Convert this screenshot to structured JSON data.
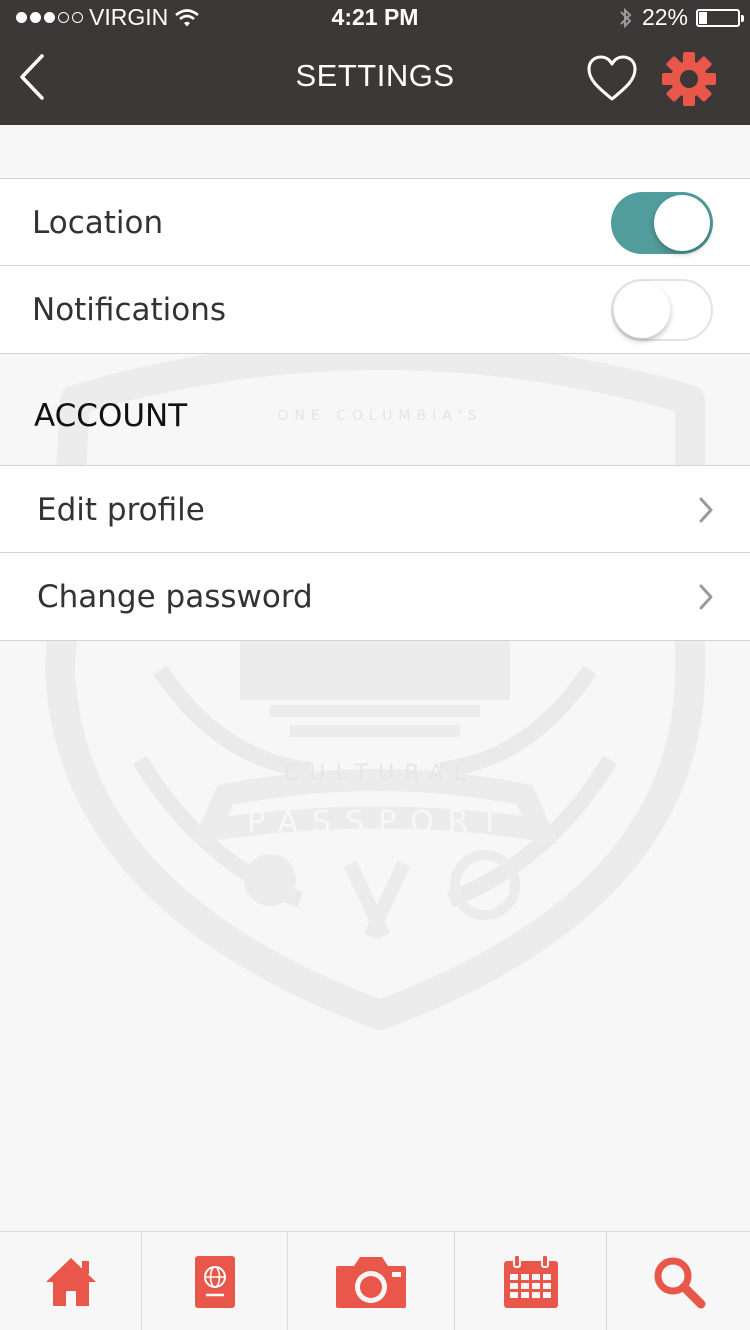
{
  "status_bar": {
    "carrier": "VIRGIN",
    "time": "4:21 PM",
    "battery": "22%",
    "battery_level": 0.22,
    "signal_bars_filled": 3,
    "signal_bars_total": 5
  },
  "nav": {
    "title": "SETTINGS",
    "back_icon": "chevron-left-icon",
    "favorite_icon": "heart-icon",
    "settings_icon": "gear-icon"
  },
  "settings": {
    "location": {
      "label": "Location",
      "enabled": true
    },
    "notifications": {
      "label": "Notifications",
      "enabled": false
    }
  },
  "account": {
    "header": "ACCOUNT",
    "items": [
      {
        "label": "Edit profile"
      },
      {
        "label": "Change password"
      }
    ]
  },
  "watermark": {
    "top_text": "ONE COLUMBIA'S",
    "middle_text": "CULTURAL",
    "banner_text": "PASSPORT"
  },
  "tabs": [
    {
      "name": "home",
      "icon": "home-icon"
    },
    {
      "name": "passport",
      "icon": "passport-icon"
    },
    {
      "name": "camera",
      "icon": "camera-icon"
    },
    {
      "name": "calendar",
      "icon": "calendar-icon"
    },
    {
      "name": "search",
      "icon": "search-icon"
    }
  ],
  "colors": {
    "header_bg": "#3d3838",
    "accent": "#e9574a",
    "toggle_on": "#519c9c",
    "background": "#f7f7f7"
  }
}
